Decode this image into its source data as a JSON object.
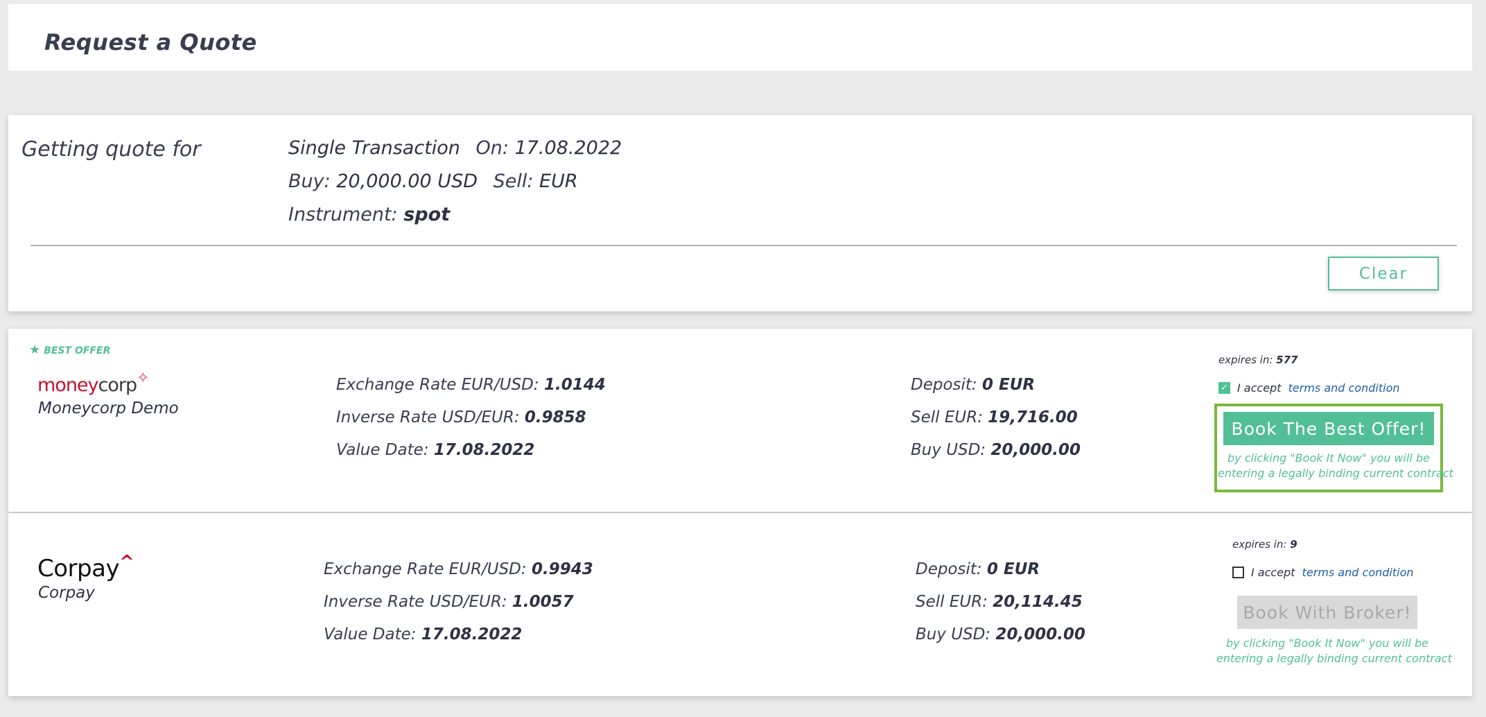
{
  "header": {
    "title": "Request a Quote"
  },
  "summary": {
    "label": "Getting quote for",
    "transaction_type": "Single Transaction",
    "on_label": "On:",
    "on_value": "17.08.2022",
    "buy_label": "Buy:",
    "buy_value": "20,000.00 USD",
    "sell_label": "Sell:",
    "sell_value": "EUR",
    "instrument_label": "Instrument:",
    "instrument_value": "spot",
    "clear_label": "Clear"
  },
  "offers": [
    {
      "badge": "BEST OFFER",
      "logo_main": "money",
      "logo_tail": "corp",
      "provider": "Moneycorp Demo",
      "exchange_label": "Exchange Rate EUR/USD:",
      "exchange_value": "1.0144",
      "inverse_label": "Inverse Rate USD/EUR:",
      "inverse_value": "0.9858",
      "value_date_label": "Value Date:",
      "value_date_value": "17.08.2022",
      "deposit_label": "Deposit:",
      "deposit_value": "0 EUR",
      "sell_label": "Sell EUR:",
      "sell_value": "19,716.00",
      "buy_label": "Buy USD:",
      "buy_value": "20,000.00",
      "expires_label": "expires in:",
      "expires_value": "577",
      "accept_label": "I accept",
      "terms_link": "terms and condition",
      "accepted": true,
      "book_label": "Book The Best Offer!",
      "disclaimer_1": "by clicking \"Book It Now\" you will be",
      "disclaimer_2": "entering a legally binding current contract"
    },
    {
      "logo_main": "Corpay",
      "provider": "Corpay",
      "exchange_label": "Exchange Rate EUR/USD:",
      "exchange_value": "0.9943",
      "inverse_label": "Inverse Rate USD/EUR:",
      "inverse_value": "1.0057",
      "value_date_label": "Value Date:",
      "value_date_value": "17.08.2022",
      "deposit_label": "Deposit:",
      "deposit_value": "0 EUR",
      "sell_label": "Sell EUR:",
      "sell_value": "20,114.45",
      "buy_label": "Buy USD:",
      "buy_value": "20,000.00",
      "expires_label": "expires in:",
      "expires_value": "9",
      "accept_label": "I accept",
      "terms_link": "terms and condition",
      "accepted": false,
      "book_label": "Book With Broker!",
      "disclaimer_1": "by clicking \"Book It Now\" you will be",
      "disclaimer_2": "entering a legally binding current contract"
    }
  ],
  "colors": {
    "accent": "#52bf96",
    "highlight_border": "#7ab83c",
    "link": "#1d5fa8",
    "brand_red": "#c8102e",
    "disabled": "#d9d9d9"
  }
}
